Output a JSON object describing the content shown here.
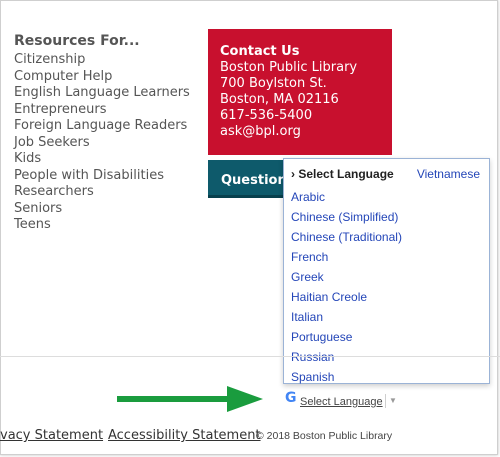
{
  "resources": {
    "heading": "Resources For...",
    "items": [
      "Citizenship",
      "Computer Help",
      "English Language Learners",
      "Entrepreneurs",
      "Foreign Language Readers",
      "Job Seekers",
      "Kids",
      "People with Disabilities",
      "Researchers",
      "Seniors",
      "Teens"
    ]
  },
  "contact": {
    "title": "Contact Us",
    "name": "Boston Public Library",
    "street": "700 Boylston St.",
    "city": "Boston, MA 02116",
    "phone": "617-536-5400",
    "email": "ask@bpl.org",
    "bg_color": "#c8102e"
  },
  "questions_button": {
    "label": "Questions"
  },
  "language_dropdown": {
    "header": "› Select Language",
    "right_option": "Vietnamese",
    "options": [
      "Arabic",
      "Chinese (Simplified)",
      "Chinese (Traditional)",
      "French",
      "Greek",
      "Haitian Creole",
      "Italian",
      "Portuguese",
      "Russian",
      "Spanish"
    ],
    "link_color": "#2446b8"
  },
  "translate_widget": {
    "logo_letter": "G",
    "label": "Select Language",
    "caret": "▼"
  },
  "annotation": {
    "arrow_color": "#1a9c3e",
    "icon": "green-right-arrow-icon"
  },
  "footer": {
    "privacy": "vacy Statement",
    "accessibility": "Accessibility Statement",
    "copyright": "© 2018 Boston Public Library"
  }
}
